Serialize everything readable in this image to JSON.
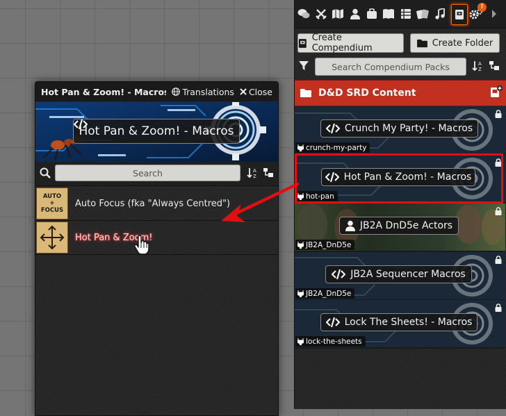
{
  "macro_window": {
    "title": "Hot Pan & Zoom! - Macros [Lo",
    "translations_label": "Translations",
    "close_label": "Close",
    "banner_label": "Hot Pan & Zoom! - Macros",
    "search_placeholder": "Search",
    "entries": [
      {
        "name": "Auto Focus (fka \"Always Centred\")",
        "icon": "auto-focus-icon",
        "image_text": [
          "AUTO",
          "+",
          "FOCUS"
        ]
      },
      {
        "name": "Hot Pan & Zoom!",
        "icon": "move-arrows-icon",
        "active": true
      }
    ]
  },
  "sidebar": {
    "tabs": [
      "chat-icon",
      "combat-icon",
      "scenes-icon",
      "actors-icon",
      "items-icon",
      "journal-icon",
      "tables-icon",
      "cards-icon",
      "playlists-icon",
      "compendium-icon",
      "settings-icon",
      "expand-icon"
    ],
    "notification_badge": "!",
    "create_compendium_label": "Create Compendium",
    "create_folder_label": "Create Folder",
    "search_placeholder": "Search Compendium Packs",
    "folder_name": "D&D SRD Content",
    "packs": [
      {
        "label": "Crunch My Party! - Macros",
        "tag": "crunch-my-party",
        "icon": "code-icon"
      },
      {
        "label": "Hot Pan & Zoom! - Macros",
        "tag": "hot-pan",
        "icon": "code-icon",
        "highlighted": true
      },
      {
        "label": "JB2A DnD5e Actors",
        "tag": "JB2A_DnD5e",
        "icon": "user-icon"
      },
      {
        "label": "JB2A Sequencer Macros",
        "tag": "JB2A_DnD5e",
        "icon": "code-icon"
      },
      {
        "label": "Lock The Sheets! - Macros",
        "tag": "lock-the-sheets",
        "icon": "code-icon"
      }
    ]
  },
  "colors": {
    "accent_orange": "#ff6400",
    "folder_red": "#c2301f",
    "annotation_red": "#e01010"
  }
}
